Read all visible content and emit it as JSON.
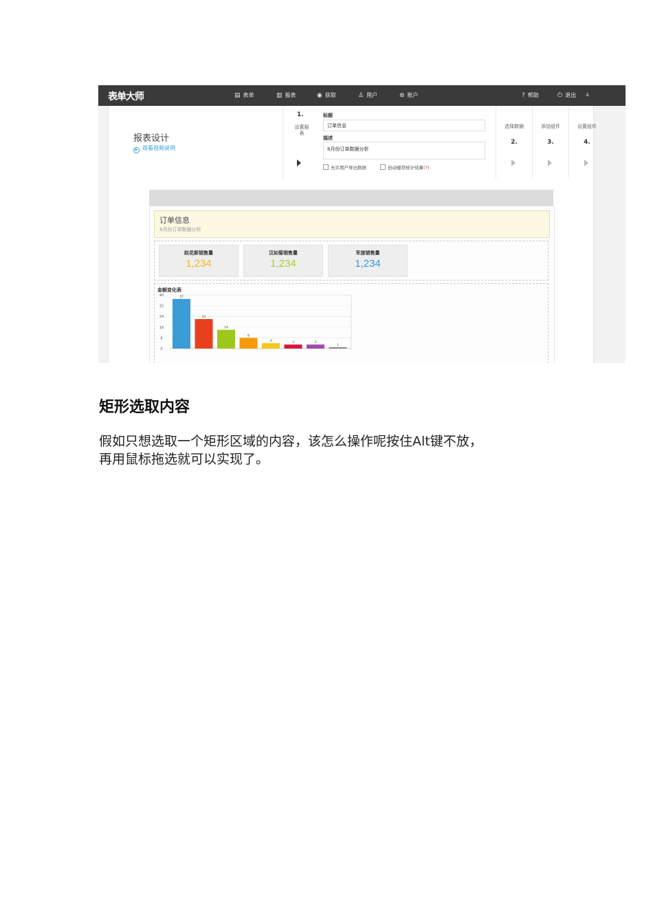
{
  "app": {
    "brand": "表单大师",
    "nav": [
      {
        "label": "表单",
        "icon": "form-icon",
        "glyph": "▤"
      },
      {
        "label": "报表",
        "icon": "report-icon",
        "glyph": "▥"
      },
      {
        "label": "获取",
        "icon": "data-icon",
        "glyph": "◉"
      },
      {
        "label": "用户",
        "icon": "user-icon",
        "glyph": "♙"
      },
      {
        "label": "账户",
        "icon": "account-icon",
        "glyph": "⊛"
      }
    ],
    "nav_right": [
      {
        "label": "帮助",
        "icon": "help-icon",
        "glyph": "?"
      },
      {
        "label": "退出",
        "icon": "power-icon",
        "glyph": "⏻"
      }
    ],
    "page_title": "报表设计",
    "video_link": "观看视频说明",
    "step1": {
      "number": "1.",
      "label": "设置报表",
      "title_label": "标题",
      "title_value": "订单信息",
      "desc_label": "描述",
      "desc_value": "8月份订单数据分析",
      "checkbox1": "允许用户导出数据",
      "checkbox2": "自动缓存统计结果",
      "checkbox2_hint": "(?)"
    },
    "steps": [
      {
        "label": "选择数据",
        "number": "2."
      },
      {
        "label": "添加组件",
        "number": "3."
      },
      {
        "label": "设置组件",
        "number": "4."
      }
    ],
    "report": {
      "title": "订单信息",
      "subtitle": "8月份订单数据分析",
      "cards": [
        {
          "title": "赵花斯销售量",
          "value": "1,234",
          "color": "#f5b81c"
        },
        {
          "title": "汉如菊销售量",
          "value": "1,234",
          "color": "#a6cf2a"
        },
        {
          "title": "军旅销售量",
          "value": "1,234",
          "color": "#3a9bd6"
        }
      ]
    }
  },
  "chart_data": {
    "type": "bar",
    "title": "金额变化表",
    "yticks": [
      "40",
      "32",
      "24",
      "16",
      "8",
      "0"
    ],
    "ylim": [
      0,
      40
    ],
    "grid": true,
    "values": [
      37,
      22,
      14,
      8,
      4,
      3,
      3,
      1
    ],
    "colors": [
      "#3a9bd6",
      "#e8401c",
      "#9ec71d",
      "#f59a0c",
      "#f7c61a",
      "#d8163f",
      "#a24ab0",
      "#888888"
    ]
  },
  "article": {
    "heading": "矩形选取内容",
    "line1": "假如只想选取一个矩形区域的内容，该怎么操作呢按住Alt键不放，",
    "line2": "再用鼠标拖选就可以实现了。"
  }
}
